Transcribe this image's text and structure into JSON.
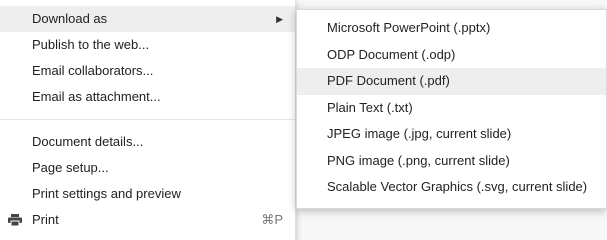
{
  "file_menu": {
    "items": [
      {
        "label": "Download as",
        "highlighted": true,
        "has_submenu": true,
        "submenu_arrow": "▶"
      },
      {
        "label": "Publish to the web..."
      },
      {
        "label": "Email collaborators..."
      },
      {
        "label": "Email as attachment..."
      },
      {
        "label": "Document details..."
      },
      {
        "label": "Page setup..."
      },
      {
        "label": "Print settings and preview"
      },
      {
        "label": "Print",
        "icon": "printer-icon",
        "shortcut": "⌘P"
      }
    ]
  },
  "download_submenu": {
    "items": [
      {
        "label": "Microsoft PowerPoint (.pptx)"
      },
      {
        "label": "ODP Document (.odp)"
      },
      {
        "label": "PDF Document (.pdf)",
        "highlighted": true
      },
      {
        "label": "Plain Text (.txt)"
      },
      {
        "label": "JPEG image (.jpg, current slide)"
      },
      {
        "label": "PNG image (.png, current slide)"
      },
      {
        "label": "Scalable Vector Graphics (.svg, current slide)"
      }
    ]
  },
  "colors": {
    "highlight": "#eeeeee",
    "text": "#222222",
    "shortcut": "#777777",
    "separator": "#e5e5e5"
  }
}
